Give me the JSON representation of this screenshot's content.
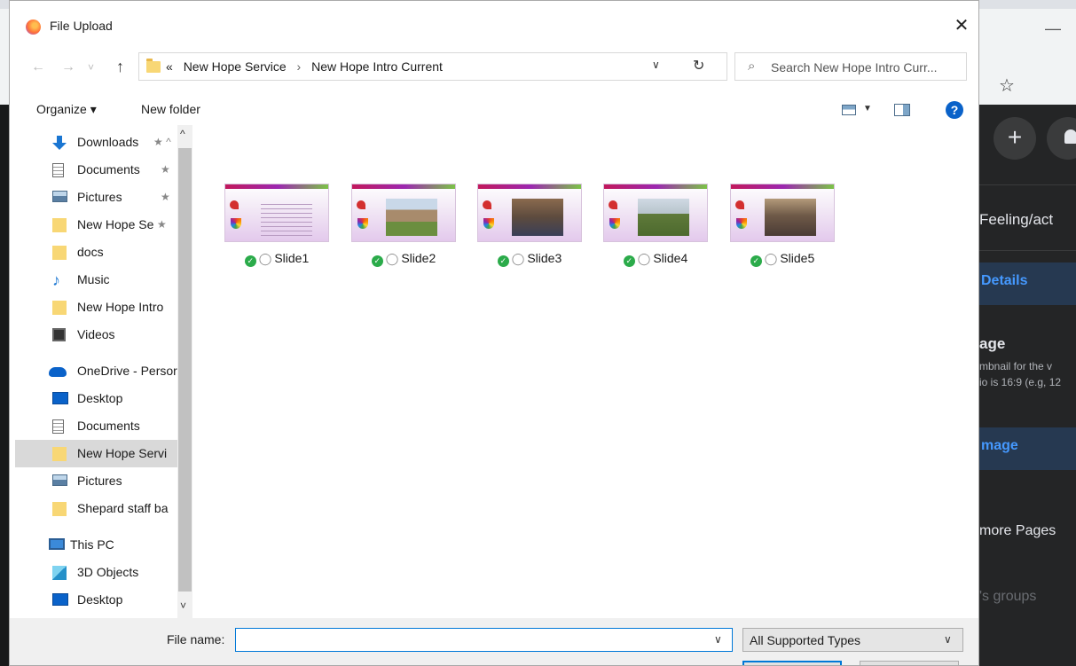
{
  "background": {
    "star_icon": "star-outline",
    "fb_labels": {
      "feeling": "Feeling/act",
      "details": "Details",
      "age": "age",
      "thumb_desc_1": "mbnail for the v",
      "thumb_desc_2": "io is 16:9 (e.g, 12",
      "image": "mage",
      "more_pages": "more Pages",
      "groups": "'s groups"
    }
  },
  "dialog": {
    "title": "File Upload",
    "close_glyph": "✕",
    "nav": {
      "back_glyph": "←",
      "forward_glyph": "→",
      "recent_glyph": "˅",
      "up_glyph": "↑",
      "overflow": "«",
      "breadcrumb": [
        "New Hope Service",
        "New Hope Intro Current"
      ],
      "separator": "›",
      "dropdown_glyph": "∨",
      "refresh_glyph": "↻",
      "search_placeholder": "Search New Hope Intro Curr..."
    },
    "toolbar": {
      "organize": "Organize ▾",
      "new_folder": "New folder",
      "help": "?",
      "view_dropdown": "▼"
    },
    "sidebar": {
      "scroll_up": "^",
      "scroll_down": "˅",
      "items": [
        {
          "label": "Downloads",
          "icon": "download-icon",
          "pinned": true,
          "pin": "★ ^"
        },
        {
          "label": "Documents",
          "icon": "documents-icon",
          "pinned": true,
          "pin": "★"
        },
        {
          "label": "Pictures",
          "icon": "pictures-icon",
          "pinned": true,
          "pin": "★"
        },
        {
          "label": "New Hope Se",
          "icon": "folder-icon",
          "pinned": true,
          "pin": "★"
        },
        {
          "label": "docs",
          "icon": "folder-icon"
        },
        {
          "label": "Music",
          "icon": "music-icon"
        },
        {
          "label": "New Hope Intro",
          "icon": "folder-icon"
        },
        {
          "label": "Videos",
          "icon": "videos-icon"
        },
        {
          "label": "OneDrive - Persor",
          "icon": "onedrive-icon"
        },
        {
          "label": "Desktop",
          "icon": "desktop-icon"
        },
        {
          "label": "Documents",
          "icon": "documents-icon"
        },
        {
          "label": "New Hope Servi",
          "icon": "folder-icon",
          "selected": true
        },
        {
          "label": "Pictures",
          "icon": "pictures-icon"
        },
        {
          "label": "Shepard staff ba",
          "icon": "folder-icon"
        },
        {
          "label": "This PC",
          "icon": "this-pc-icon"
        },
        {
          "label": "3D Objects",
          "icon": "3d-objects-icon"
        },
        {
          "label": "Desktop",
          "icon": "desktop-icon"
        }
      ]
    },
    "files": [
      {
        "name": "Slide1",
        "kind": "text"
      },
      {
        "name": "Slide2",
        "kind": "building"
      },
      {
        "name": "Slide3",
        "kind": "group"
      },
      {
        "name": "Slide4",
        "kind": "outdoor"
      },
      {
        "name": "Slide5",
        "kind": "crowd"
      }
    ],
    "footer": {
      "file_name_label": "File name:",
      "file_name_value": "",
      "file_type": "All Supported Types",
      "dropdown_glyph": "∨"
    }
  }
}
